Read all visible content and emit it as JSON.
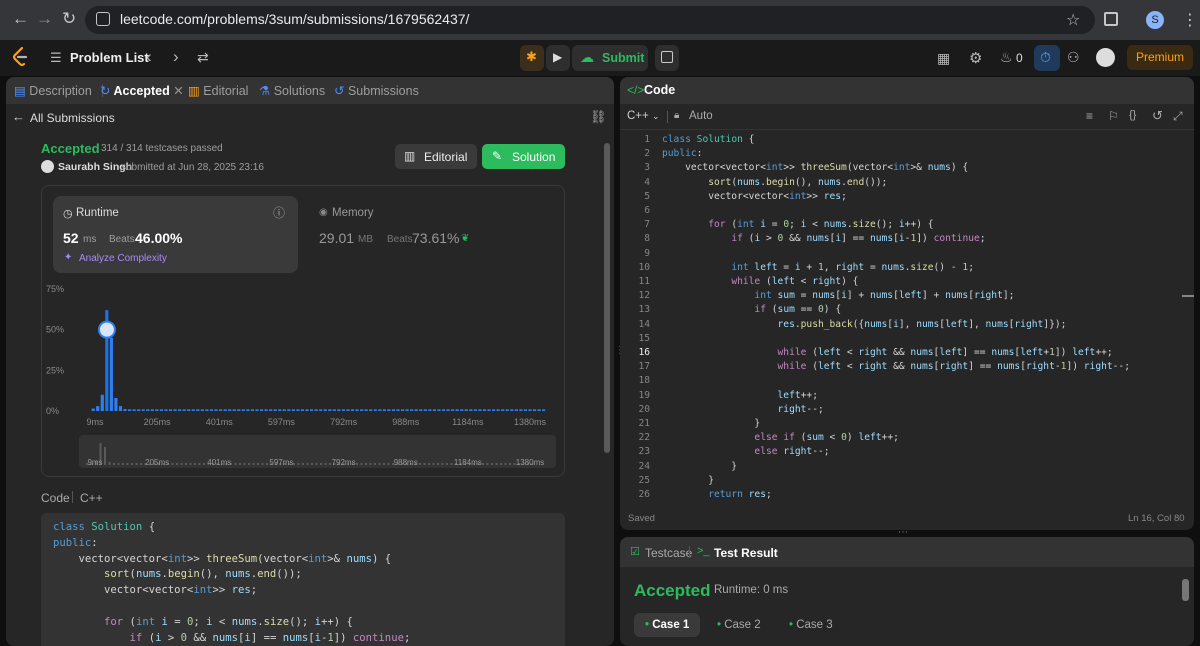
{
  "browser": {
    "url": "leetcode.com/problems/3sum/submissions/1679562437/",
    "profile_letter": "S"
  },
  "header": {
    "problem_list": "Problem List",
    "submit": "Submit",
    "coins": "0",
    "premium": "Premium"
  },
  "left_tabs": [
    {
      "label": "Description"
    },
    {
      "label": "Accepted"
    },
    {
      "label": "Editorial"
    },
    {
      "label": "Solutions"
    },
    {
      "label": "Submissions"
    }
  ],
  "submission": {
    "back_label": "All Submissions",
    "status": "Accepted",
    "testcases": "314 / 314 testcases passed",
    "user": "Saurabh Singh",
    "submitted_text": "submitted at Jun 28, 2025 23:16",
    "editorial_btn": "Editorial",
    "solution_btn": "Solution"
  },
  "runtime": {
    "title": "Runtime",
    "value": "52",
    "unit": "ms",
    "beats_label": "Beats",
    "beats": "46.00%",
    "analyze": "Analyze Complexity"
  },
  "memory": {
    "title": "Memory",
    "value": "29.01",
    "unit": "MB",
    "beats_label": "Beats",
    "beats": "73.61%"
  },
  "chart_data": {
    "type": "bar",
    "ylim": [
      0,
      75
    ],
    "yticks": [
      "75%",
      "50%",
      "25%",
      "0%"
    ],
    "xticks": [
      "9ms",
      "205ms",
      "401ms",
      "597ms",
      "792ms",
      "988ms",
      "1184ms",
      "1380ms"
    ],
    "highlight": {
      "x": "52ms",
      "value": 50
    },
    "values": [
      1.5,
      3,
      10,
      62,
      45,
      8,
      3,
      1.2,
      1,
      1,
      1,
      1,
      1,
      1,
      1,
      1,
      1,
      1,
      1,
      1,
      1,
      1,
      1,
      1,
      1,
      1,
      1,
      1,
      1,
      1,
      1,
      1,
      1,
      1,
      1,
      1,
      1,
      1,
      1,
      1,
      1,
      1,
      1,
      1,
      1,
      1,
      1,
      1,
      1,
      1,
      1,
      1,
      1,
      1,
      1,
      1,
      1,
      1,
      1,
      1,
      1,
      1,
      1,
      1,
      1,
      1,
      1,
      1,
      1,
      1,
      1,
      1,
      1,
      1,
      1,
      1,
      1,
      1,
      1,
      1,
      1,
      1,
      1,
      1,
      1,
      1,
      1,
      1,
      1,
      1,
      1,
      1,
      1,
      1,
      1,
      1,
      1,
      1,
      1,
      1
    ],
    "overview_ticks": [
      "9ms",
      "205ms",
      "401ms",
      "597ms",
      "792ms",
      "988ms",
      "1184ms",
      "1380ms"
    ]
  },
  "left_code": {
    "label": "Code",
    "lang": "C++"
  },
  "editor": {
    "title": "Code",
    "lang": "C++",
    "mode": "Auto",
    "saved": "Saved",
    "position": "Ln 16, Col 80"
  },
  "bottom": {
    "tab_testcase": "Testcase",
    "tab_result": "Test Result",
    "status": "Accepted",
    "runtime": "Runtime: 0 ms",
    "cases": [
      "Case 1",
      "Case 2",
      "Case 3"
    ]
  },
  "code_lines": [
    "class Solution {",
    "public:",
    "    vector<vector<int>> threeSum(vector<int>& nums) {",
    "        sort(nums.begin(), nums.end());",
    "        vector<vector<int>> res;",
    "",
    "        for (int i = 0; i < nums.size(); i++) {",
    "            if (i > 0 && nums[i] == nums[i-1]) continue;",
    "",
    "            int left = i + 1, right = nums.size() - 1;",
    "            while (left < right) {",
    "                int sum = nums[i] + nums[left] + nums[right];",
    "                if (sum == 0) {",
    "                    res.push_back({nums[i], nums[left], nums[right]});",
    "",
    "                    while (left < right && nums[left] == nums[left+1]) left++;",
    "                    while (left < right && nums[right] == nums[right-1]) right--;",
    "",
    "                    left++;",
    "                    right--;",
    "                }",
    "                else if (sum < 0) left++;",
    "                else right--;",
    "            }",
    "        }",
    "        return res;"
  ]
}
